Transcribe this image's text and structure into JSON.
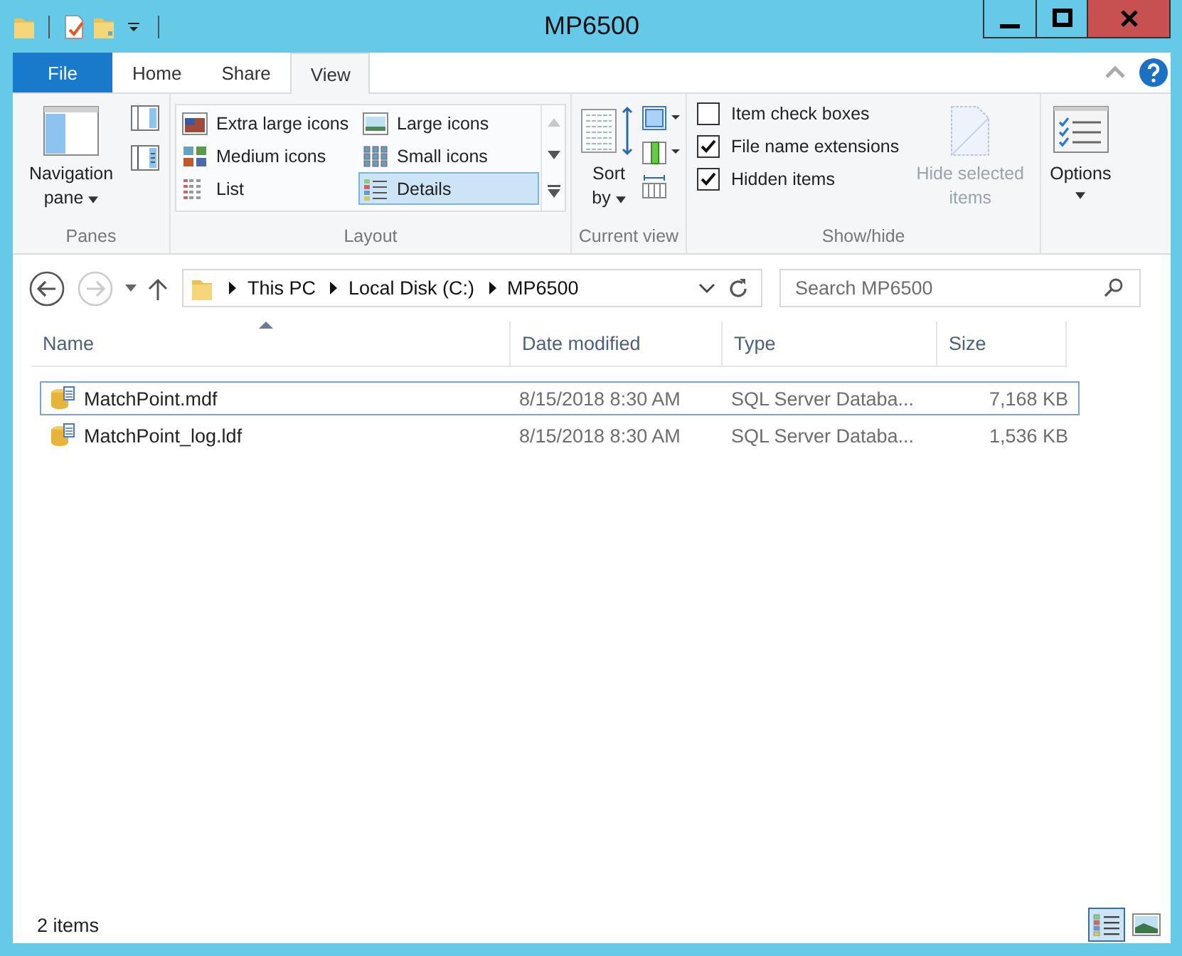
{
  "window": {
    "title": "MP6500"
  },
  "ribbon_tabs": [
    {
      "label": "File",
      "kind": "file"
    },
    {
      "label": "Home",
      "kind": "tab",
      "selected": false
    },
    {
      "label": "Share",
      "kind": "tab",
      "selected": false
    },
    {
      "label": "View",
      "kind": "tab",
      "selected": true
    }
  ],
  "panes": {
    "navigation_pane": "Navigation pane",
    "label": "Panes"
  },
  "layout": {
    "label": "Layout",
    "items": [
      {
        "label": "Extra large icons",
        "selected": false
      },
      {
        "label": "Large icons",
        "selected": false
      },
      {
        "label": "Medium icons",
        "selected": false
      },
      {
        "label": "Small icons",
        "selected": false
      },
      {
        "label": "List",
        "selected": false
      },
      {
        "label": "Details",
        "selected": true
      }
    ]
  },
  "current_view": {
    "sort_by": "Sort by",
    "label": "Current view"
  },
  "show_hide": {
    "label": "Show/hide",
    "checkboxes": [
      {
        "label": "Item check boxes",
        "checked": false
      },
      {
        "label": "File name extensions",
        "checked": true
      },
      {
        "label": "Hidden items",
        "checked": true
      }
    ],
    "hide_selected": {
      "label": "Hide selected items",
      "disabled": true
    }
  },
  "options": {
    "label": "Options"
  },
  "address": {
    "crumbs": [
      "This PC",
      "Local Disk (C:)",
      "MP6500"
    ]
  },
  "search": {
    "placeholder": "Search MP6500"
  },
  "table": {
    "columns": [
      {
        "label": "Name",
        "sorted": true
      },
      {
        "label": "Date modified",
        "sorted": false
      },
      {
        "label": "Type",
        "sorted": false
      },
      {
        "label": "Size",
        "sorted": false
      }
    ],
    "rows": [
      {
        "name": "MatchPoint.mdf",
        "date": "8/15/2018 8:30 AM",
        "type": "SQL Server Databa...",
        "size": "7,168 KB",
        "focused": true
      },
      {
        "name": "MatchPoint_log.ldf",
        "date": "8/15/2018 8:30 AM",
        "type": "SQL Server Databa...",
        "size": "1,536 KB",
        "focused": false
      }
    ]
  },
  "status_bar": {
    "count": "2 items",
    "views": [
      {
        "kind": "details",
        "selected": true
      },
      {
        "kind": "large",
        "selected": false
      }
    ]
  }
}
